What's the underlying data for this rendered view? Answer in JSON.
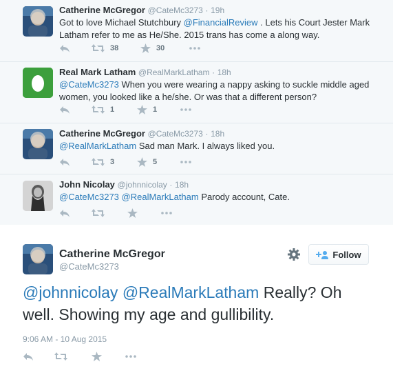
{
  "thread": [
    {
      "name": "Catherine McGregor",
      "handle": "@CateMc3273",
      "time": "19h",
      "line1": "Got to love Michael Stutchbury",
      "mention1": "@FinancialReview",
      "line1b": ". Lets his Court Jester Mark",
      "line2": "Latham refer to me as He/She. 2015 trans has come a along way.",
      "retweets": "38",
      "favorites": "30"
    },
    {
      "name": "Real Mark Latham",
      "handle": "@RealMarkLatham",
      "time": "18h",
      "mention1": "@CateMc3273",
      "line1b": "When you were wearing a nappy asking to suckle middle aged",
      "line2": "women, you looked like a he/she. Or was that a different person?",
      "retweets": "1",
      "favorites": "1"
    },
    {
      "name": "Catherine McGregor",
      "handle": "@CateMc3273",
      "time": "18h",
      "mention1": "@RealMarkLatham",
      "line1b": "Sad man Mark. I always liked you.",
      "retweets": "3",
      "favorites": "5"
    },
    {
      "name": "John Nicolay",
      "handle": "@johnnicolay",
      "time": "18h",
      "mention1": "@CateMc3273",
      "mention2": "@RealMarkLatham",
      "line1b": "Parody account, Cate."
    }
  ],
  "main": {
    "name": "Catherine McGregor",
    "handle": "@CateMc3273",
    "follow_label": "Follow",
    "mention1": "@johnnicolay",
    "mention2": "@RealMarkLatham",
    "text1": "Really? Oh",
    "text2": "well. Showing my age and gullibility.",
    "timestamp": "9:06 AM - 10 Aug 2015"
  },
  "icons": [
    "reply-icon",
    "retweet-icon",
    "favorite-icon",
    "more-icon",
    "gear-icon",
    "follow-person-icon",
    "egg-icon"
  ],
  "colors": {
    "link": "#2b7bb9",
    "muted": "#8899a6",
    "egg_bg": "#3c9f3c",
    "thread_bg": "#f5f8fa"
  }
}
